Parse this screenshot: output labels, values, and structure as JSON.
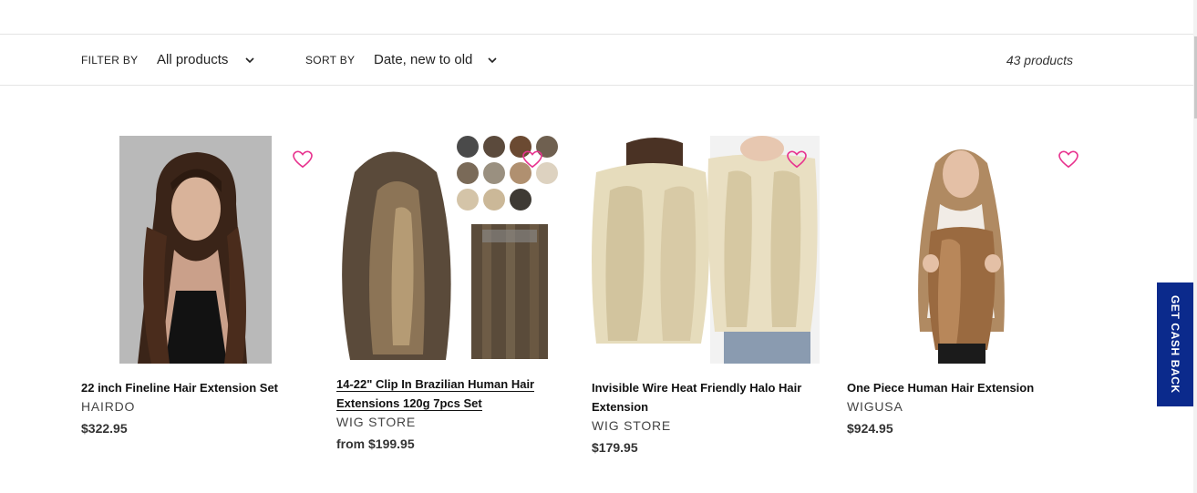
{
  "filter": {
    "label": "FILTER BY",
    "value": "All products"
  },
  "sort": {
    "label": "SORT BY",
    "value": "Date, new to old"
  },
  "count": "43 products",
  "products": [
    {
      "title_line1": "22 inch Fineline Hair Extension Set",
      "title_line2": "",
      "vendor": "HAIRDO",
      "price": "$322.95"
    },
    {
      "title_line1": "14-22\" Clip In Brazilian Human Hair",
      "title_line2": "Extensions 120g 7pcs Set",
      "vendor": "WIG STORE",
      "price": "from $199.95"
    },
    {
      "title_line1": "Invisible Wire Heat Friendly Halo Hair",
      "title_line2": "Extension",
      "vendor": "WIG STORE",
      "price": "$179.95"
    },
    {
      "title_line1": "One Piece Human Hair Extension",
      "title_line2": "",
      "vendor": "WIGUSA",
      "price": "$924.95"
    }
  ],
  "cashback": "GET CASH BACK",
  "colors": {
    "heart": "#e8348f",
    "cashback_bg": "#0b2a8c"
  },
  "icons": {
    "wishlist": "heart-outline-icon",
    "dropdown": "chevron-down-icon"
  }
}
